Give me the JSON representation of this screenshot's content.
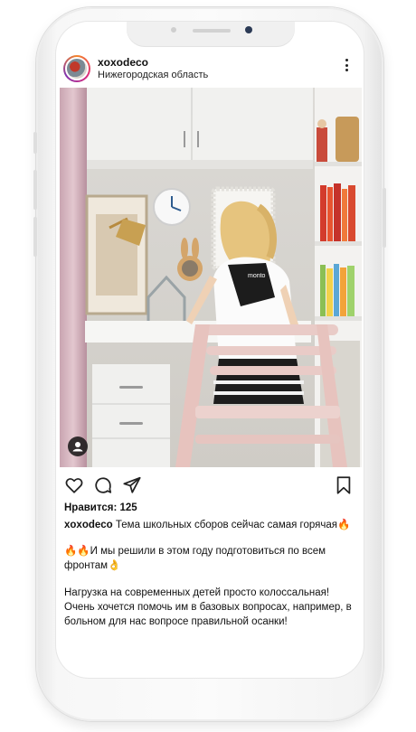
{
  "post": {
    "username": "xoxodeco",
    "location": "Нижегородская область",
    "likes_text": "Нравится: 125",
    "caption_username": "xoxodeco",
    "caption_text": "Тема школьных сборов сейчас самая горячая🔥",
    "para1": "🔥🔥И мы решили в этом году подготовиться по всем фронтам👌",
    "para2": "Нагрузка на современных детей просто колоссальная! Очень хочется помочь им в базовых вопросах, например, в больном для нас вопросе правильной осанки!"
  },
  "photo": {
    "corrector_brand": "monto",
    "description": "girl at desk wearing posture corrector"
  },
  "icons": {
    "like": "heart-icon",
    "comment": "comment-icon",
    "share": "send-icon",
    "save": "bookmark-icon",
    "more": "more-vertical-icon",
    "tag": "user-tag-icon"
  },
  "colors": {
    "text": "#111111",
    "avatar_ring": "#dd2a7b"
  }
}
